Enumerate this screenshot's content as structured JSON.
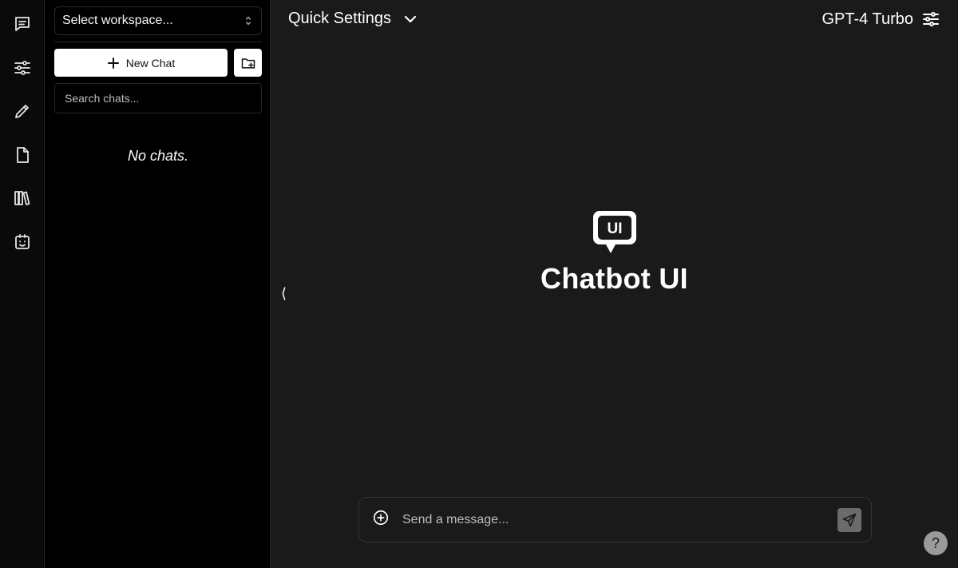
{
  "sidebar": {
    "workspace_select": {
      "label": "Select workspace..."
    },
    "new_chat_label": "New Chat",
    "search_placeholder": "Search chats...",
    "empty_text": "No chats."
  },
  "rail": {
    "items": [
      {
        "icon": "chats-icon"
      },
      {
        "icon": "presets-icon"
      },
      {
        "icon": "prompts-icon"
      },
      {
        "icon": "files-icon"
      },
      {
        "icon": "collections-icon"
      },
      {
        "icon": "assistants-icon"
      }
    ]
  },
  "header": {
    "quick_settings_label": "Quick Settings",
    "model_label": "GPT-4 Turbo"
  },
  "main": {
    "collapse_glyph": "⟨",
    "brand_logo_text": "UI",
    "brand_name": "Chatbot UI"
  },
  "composer": {
    "placeholder": "Send a message..."
  },
  "help": {
    "label": "?"
  },
  "colors": {
    "background": "#1a1a1a",
    "sidebar": "#000000",
    "rail": "#0a0a0a",
    "button_bg": "#ffffff",
    "send_button": "#6b6b6b"
  }
}
